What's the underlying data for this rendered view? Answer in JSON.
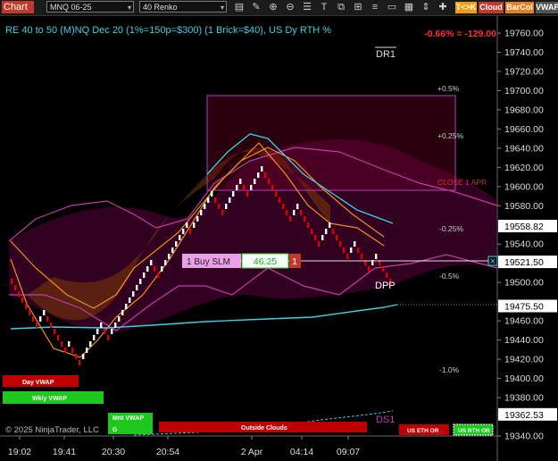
{
  "toolbar": {
    "title": "Chart",
    "instrument": "MNQ 06-25",
    "bar_type": "40 Renko",
    "icons": [
      "bar-style-icon",
      "pencil-icon",
      "zoom-in-icon",
      "zoom-out-icon",
      "properties-icon",
      "text-icon",
      "copy-icon",
      "split-icon",
      "list-icon",
      "rectangle-icon",
      "grid-icon",
      "scroll-icon",
      "plus-icon"
    ],
    "buttons": [
      {
        "label": "T<>K",
        "color": "#f39c12"
      },
      {
        "label": "Cloud",
        "color": "#c0392b"
      },
      {
        "label": "BarCol",
        "color": "#e67e22"
      },
      {
        "label": "VWAP",
        "color": "#555555"
      }
    ]
  },
  "header": {
    "title": "RE 40 to 50 (M)NQ Dec 20 (1%=150p=$300) (1 Brick=$40), US Dy RTH %",
    "change": "-0.66% = -129.00"
  },
  "colors": {
    "bull": "#ffffff",
    "bear": "#e00000",
    "cyan": "#3fd0e0",
    "orange": "#f0901e",
    "magenta": "#c03ca8"
  },
  "price_axis": {
    "ticks": [
      "19760.00",
      "19740.00",
      "19720.00",
      "19700.00",
      "19680.00",
      "19660.00",
      "19640.00",
      "19620.00",
      "19600.00",
      "19580.00",
      "19540.00",
      "19500.00",
      "19460.00",
      "19440.00",
      "19420.00",
      "19400.00",
      "19380.00",
      "19340.00"
    ],
    "markers": [
      {
        "label": "19558.82",
        "price": 19558.82,
        "bg": "#ffffff"
      },
      {
        "label": "19521.50",
        "price": 19521.5,
        "bg": "#ffffff"
      },
      {
        "label": "19475.50",
        "price": 19475.5,
        "bg": "#ffffff"
      },
      {
        "label": "19362.53",
        "price": 19362.53,
        "bg": "#ffffff"
      }
    ]
  },
  "time_axis": {
    "labels": [
      "19:02",
      "19:41",
      "20:30",
      "20:54",
      "2 Apr",
      "04:14",
      "09:07"
    ]
  },
  "annotations": {
    "dr1": "DR1",
    "dpp": "DPP",
    "ds1": "DS1",
    "close_label": "CLOSE 1 APR",
    "pct_up_05": "+0.5%",
    "pct_up_025": "+0.25%",
    "pct_dn_025": "-0.25%",
    "pct_dn_05": "-0.5%",
    "pct_dn_10": "-1.0%"
  },
  "order": {
    "label": "1 Buy SLM",
    "price": "46.25",
    "qty": "1",
    "close_icon": "×"
  },
  "footer_tags": {
    "day_vwap": "Day VWAP",
    "wkly_vwap": "Wkly VWAP",
    "mnt_vwap": "Mnt VWAP",
    "mnt_sub": "G",
    "outside_clouds": "Outside Clouds",
    "us_eth": "US ETH OR",
    "us_rth": "US RTH OR",
    "copyright": "© 2025 NinjaTrader, LLC"
  }
}
